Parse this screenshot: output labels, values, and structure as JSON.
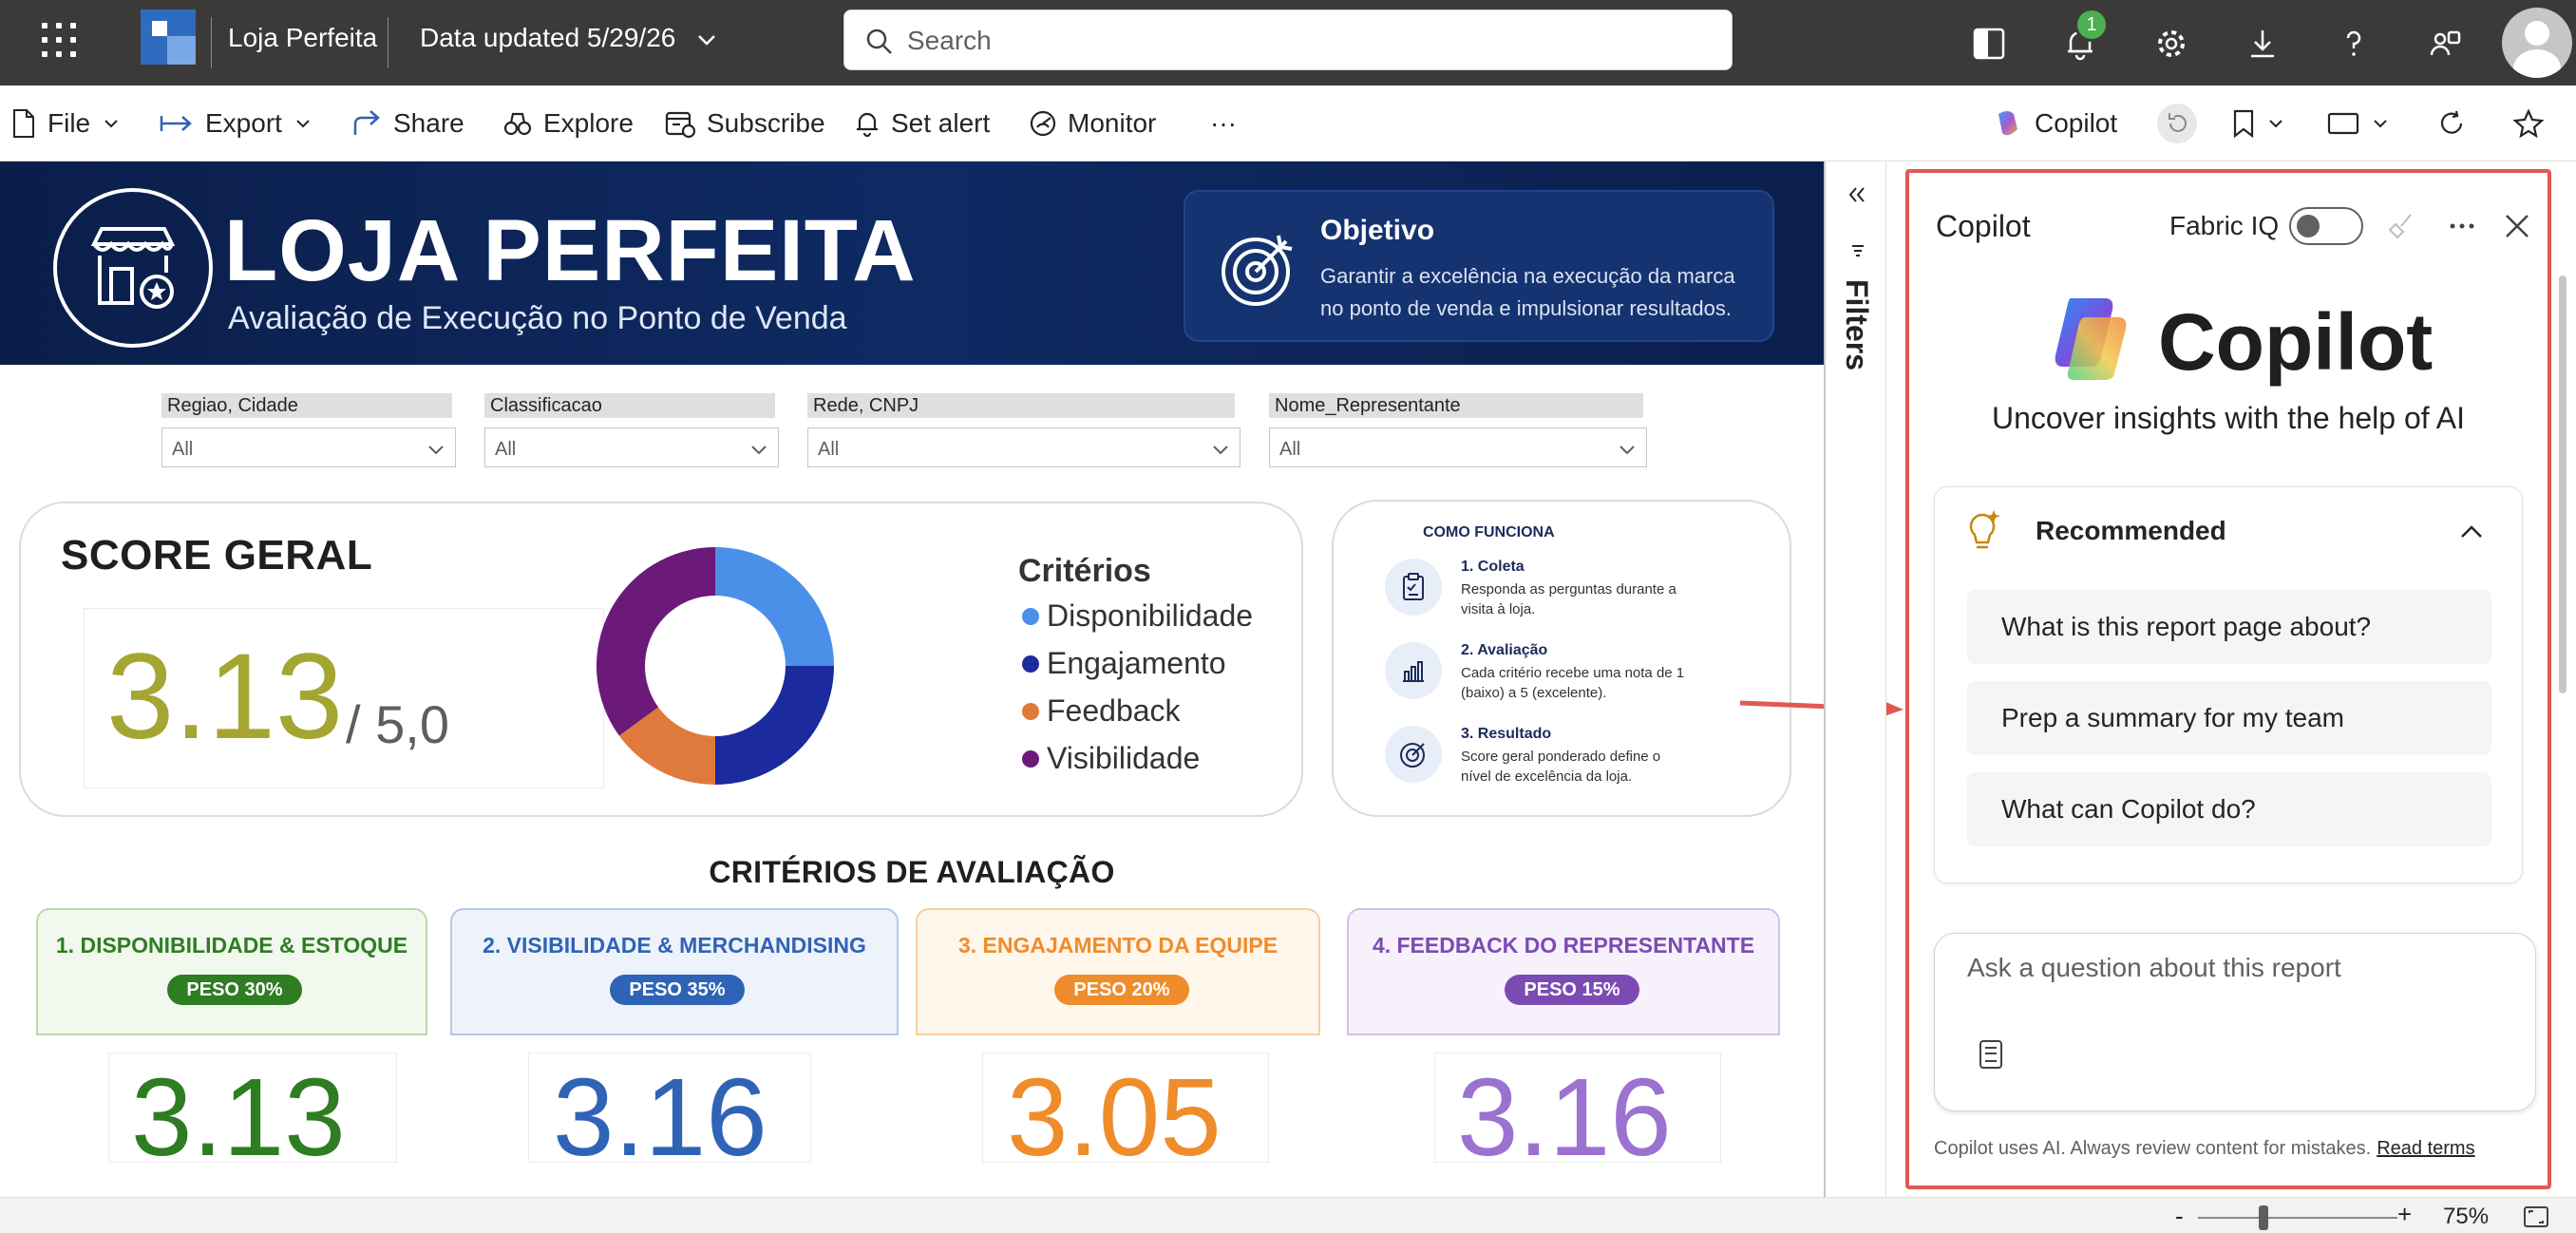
{
  "header": {
    "report_name": "Loja Perfeita",
    "data_updated": "Data updated 5/29/26",
    "search_placeholder": "Search",
    "notification_count": "1"
  },
  "actionbar": {
    "file": "File",
    "export": "Export",
    "share": "Share",
    "explore": "Explore",
    "subscribe": "Subscribe",
    "set_alert": "Set alert",
    "monitor": "Monitor",
    "more": "···",
    "copilot": "Copilot"
  },
  "report": {
    "brand_title": "LOJA PERFEITA",
    "brand_subtitle": "Avaliação de Execução no Ponto de Venda",
    "objective_title": "Objetivo",
    "objective_text": "Garantir a excelência na execução da marca no ponto de venda e impulsionar resultados.",
    "slicers": [
      {
        "label": "Regiao, Cidade",
        "value": "All"
      },
      {
        "label": "Classificacao",
        "value": "All"
      },
      {
        "label": "Rede, CNPJ",
        "value": "All"
      },
      {
        "label": "Nome_Representante",
        "value": "All"
      }
    ],
    "score_title": "SCORE GERAL",
    "score_value": "3.13",
    "score_max": "/ 5,0",
    "legend_title": "Critérios",
    "how_it_works": {
      "title": "COMO FUNCIONA",
      "steps": [
        {
          "title": "1. Coleta",
          "text": "Responda as perguntas durante a visita à loja."
        },
        {
          "title": "2. Avaliação",
          "text": "Cada critério recebe uma nota de 1 (baixo) a 5 (excelente)."
        },
        {
          "title": "3. Resultado",
          "text": "Score geral ponderado define o nível de excelência da loja."
        }
      ]
    },
    "criteria_title": "CRITÉRIOS DE AVALIAÇÃO",
    "criteria": [
      {
        "title": "1. DISPONIBILIDADE & ESTOQUE",
        "weight": "PESO 30%",
        "value": "3.13",
        "color": "#2e7d22",
        "bg": "#f1f8ee",
        "border": "#b7dba8"
      },
      {
        "title": "2. VISIBILIDADE & MERCHANDISING",
        "weight": "PESO 35%",
        "value": "3.16",
        "color": "#2f63b5",
        "bg": "#eef3fb",
        "border": "#b3c7ea"
      },
      {
        "title": "3. ENGAJAMENTO DA EQUIPE",
        "weight": "PESO 20%",
        "value": "3.05",
        "color": "#ef8c2b",
        "bg": "#fff6ec",
        "border": "#f6cf9f"
      },
      {
        "title": "4. FEEDBACK DO REPRESENTANTE",
        "weight": "PESO 15%",
        "value": "3.16",
        "color": "#7b4bb3",
        "bg": "#f6f1fb",
        "border": "#d3c0ea"
      }
    ]
  },
  "chart_data": {
    "type": "pie",
    "donut": true,
    "categories": [
      "Disponibilidade",
      "Engajamento",
      "Feedback",
      "Visibilidade"
    ],
    "values": [
      25,
      25,
      15,
      35
    ],
    "colors": [
      "#4a90e8",
      "#1b2a9c",
      "#e07a3c",
      "#6b1a7a"
    ],
    "legend": "right"
  },
  "filters": {
    "label": "Filters"
  },
  "copilot": {
    "title": "Copilot",
    "fabric_iq": "Fabric IQ",
    "logo_text": "Copilot",
    "tagline": "Uncover insights with the help of AI",
    "recommended": "Recommended",
    "suggestions": [
      "What is this report page about?",
      "Prep a summary for my team",
      "What can Copilot do?"
    ],
    "input_placeholder": "Ask a question about this report",
    "footer_text": "Copilot uses AI. Always review content for mistakes.",
    "footer_link": "Read terms"
  },
  "statusbar": {
    "zoom_minus": "-",
    "zoom_plus": "+",
    "zoom": "75%"
  },
  "icons": [
    "app-launcher-icon",
    "powerbi-logo-icon",
    "chevron-down-icon",
    "search-icon",
    "reading-view-icon",
    "bell-icon",
    "gear-icon",
    "download-icon",
    "help-icon",
    "share-people-icon",
    "file-icon",
    "export-icon",
    "share-icon",
    "explore-icon",
    "subscribe-icon",
    "alert-icon",
    "monitor-icon",
    "copilot-icon",
    "undo-icon",
    "bookmark-icon",
    "view-icon",
    "refresh-icon",
    "star-icon",
    "collapse-icon",
    "filter-icon",
    "broom-icon",
    "more-icon",
    "close-icon",
    "lightbulb-icon",
    "chevron-up-icon",
    "prompt-guide-icon",
    "fit-page-icon"
  ]
}
